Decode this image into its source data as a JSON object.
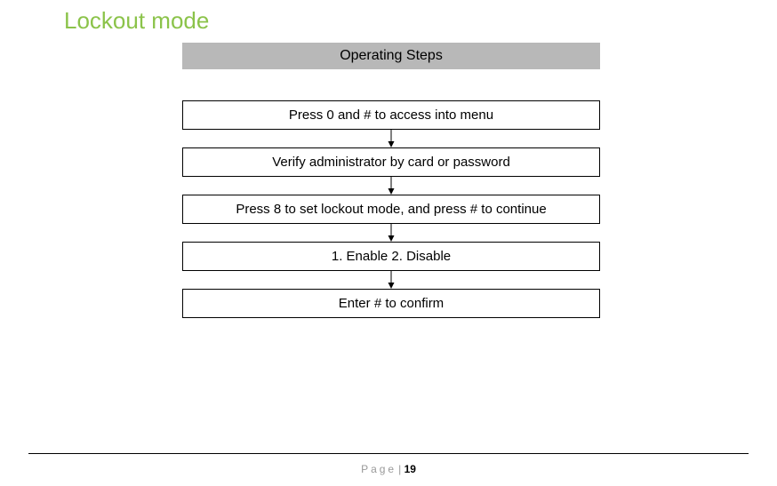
{
  "title": "Lockout mode",
  "header": "Operating Steps",
  "steps": [
    "Press  0  and  #  to access into menu",
    "Verify administrator by card or password",
    "Press 8 to set lockout mode, and press # to continue",
    "1. Enable 2. Disable",
    "Enter # to confirm"
  ],
  "footer": {
    "label": "Page",
    "separator": "|",
    "number": "19"
  }
}
